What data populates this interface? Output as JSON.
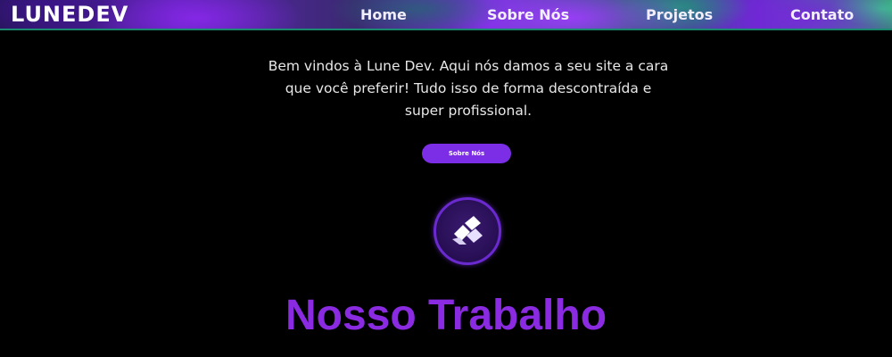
{
  "header": {
    "logo_text": "LUNEDEV",
    "nav": {
      "home": "Home",
      "sobre": "Sobre Nós",
      "projetos": "Projetos",
      "contato": "Contato"
    }
  },
  "hero": {
    "intro_line1": "Bem vindos à Lune Dev. Aqui nós damos a seu site a cara",
    "intro_line2": "que você preferir! Tudo isso de forma descontraída e",
    "intro_line3": "super profissional.",
    "cta_label": "Sobre Nós",
    "emblem_icon": "lune-logo-icon"
  },
  "work": {
    "title": "Nosso Trabalho"
  },
  "colors": {
    "accent": "#7b2ee6",
    "title": "#8a2be2",
    "background": "#000000"
  }
}
